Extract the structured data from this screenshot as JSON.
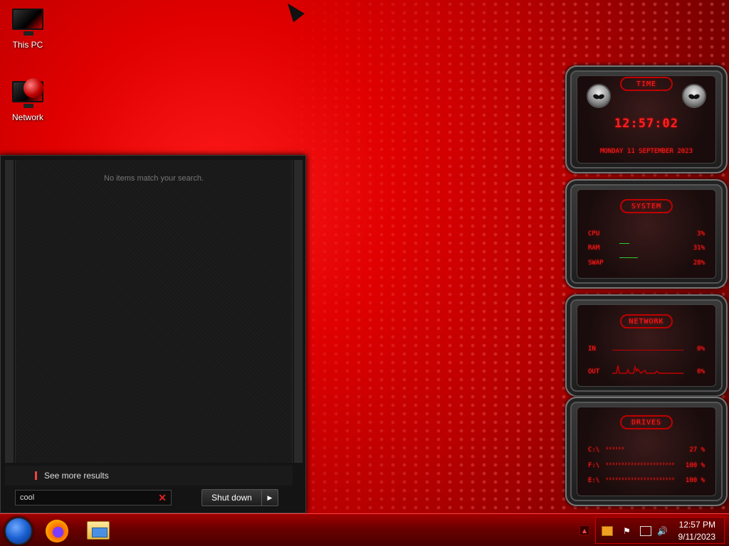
{
  "desktop": {
    "icons": [
      {
        "label": "This PC",
        "icon": "monitor-icon"
      },
      {
        "label": "Network",
        "icon": "network-globe-icon"
      }
    ]
  },
  "start_menu": {
    "no_items_text": "No items match your search.",
    "see_more_label": "See more results",
    "search_value": "cool",
    "shutdown_label": "Shut down"
  },
  "gadgets": {
    "time": {
      "title": "TIME",
      "clock": "12:57:02",
      "date": "MONDAY 11 SEPTEMBER 2023"
    },
    "system": {
      "title": "SYSTEM",
      "rows": [
        {
          "label": "CPU",
          "value": "3%"
        },
        {
          "label": "RAM",
          "value": "31%"
        },
        {
          "label": "SWAP",
          "value": "28%"
        }
      ]
    },
    "network": {
      "title": "NETWORK",
      "rows": [
        {
          "label": "IN",
          "value": "0%"
        },
        {
          "label": "OUT",
          "value": "0%"
        }
      ]
    },
    "drives": {
      "title": "DRIVES",
      "rows": [
        {
          "label": "C:\\",
          "value": "27 %",
          "fill": 0.27
        },
        {
          "label": "F:\\",
          "value": "100 %",
          "fill": 1.0
        },
        {
          "label": "E:\\",
          "value": "100 %",
          "fill": 1.0
        }
      ]
    }
  },
  "taskbar": {
    "apps": [
      "start-orb-icon",
      "firefox-icon",
      "file-explorer-icon"
    ],
    "clock_time": "12:57 PM",
    "clock_date": "9/11/2023"
  },
  "colors": {
    "accent_red": "#ff2020",
    "taskbar": "#6a0000"
  }
}
